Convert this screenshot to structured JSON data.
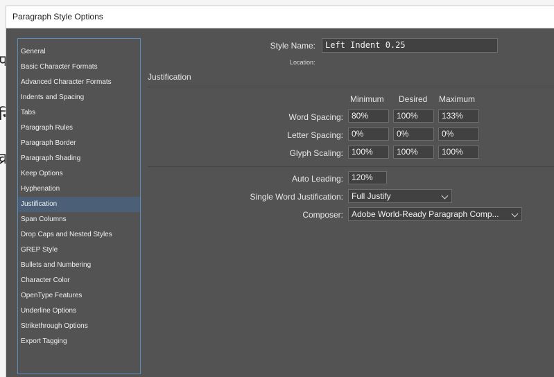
{
  "window": {
    "title": "Paragraph Style Options"
  },
  "background_glyphs": [
    "प",
    "नि",
    "व्र"
  ],
  "sidebar": {
    "items": [
      {
        "label": "General"
      },
      {
        "label": "Basic Character Formats"
      },
      {
        "label": "Advanced Character Formats"
      },
      {
        "label": "Indents and Spacing"
      },
      {
        "label": "Tabs"
      },
      {
        "label": "Paragraph Rules"
      },
      {
        "label": "Paragraph Border"
      },
      {
        "label": "Paragraph Shading"
      },
      {
        "label": "Keep Options"
      },
      {
        "label": "Hyphenation"
      },
      {
        "label": "Justification",
        "selected": true
      },
      {
        "label": "Span Columns"
      },
      {
        "label": "Drop Caps and Nested Styles"
      },
      {
        "label": "GREP Style"
      },
      {
        "label": "Bullets and Numbering"
      },
      {
        "label": "Character Color"
      },
      {
        "label": "OpenType Features"
      },
      {
        "label": "Underline Options"
      },
      {
        "label": "Strikethrough Options"
      },
      {
        "label": "Export Tagging"
      }
    ]
  },
  "style": {
    "name_label": "Style Name:",
    "name_value": "Left Indent 0.25",
    "location_label": "Location:"
  },
  "justification": {
    "section_title": "Justification",
    "headers": {
      "minimum": "Minimum",
      "desired": "Desired",
      "maximum": "Maximum"
    },
    "rows": [
      {
        "label": "Word Spacing:",
        "min": "80%",
        "desired": "100%",
        "max": "133%"
      },
      {
        "label": "Letter Spacing:",
        "min": "0%",
        "desired": "0%",
        "max": "0%"
      },
      {
        "label": "Glyph Scaling:",
        "min": "100%",
        "desired": "100%",
        "max": "100%"
      }
    ],
    "auto_leading_label": "Auto Leading:",
    "auto_leading_value": "120%",
    "single_word_label": "Single Word Justification:",
    "single_word_value": "Full Justify",
    "composer_label": "Composer:",
    "composer_value": "Adobe World-Ready Paragraph Comp..."
  },
  "colors": {
    "dialog_bg": "#535353",
    "selected_item": "#4b6076",
    "sidebar_border": "#5b8fc4"
  }
}
